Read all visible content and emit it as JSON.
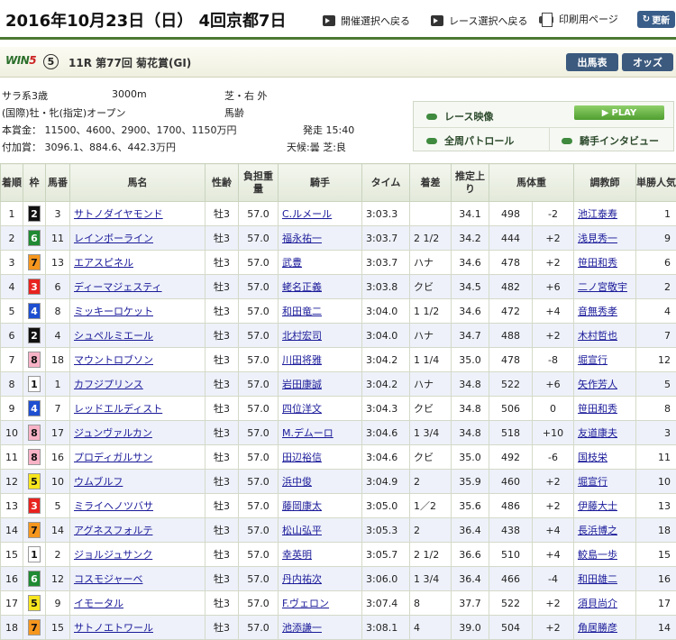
{
  "header": {
    "date": "2016年10月23日（日） 4回京都7日",
    "links": [
      "開催選択へ戻る",
      "レース選択へ戻る",
      "印刷用ページ"
    ],
    "refresh": "更新"
  },
  "race": {
    "win5_text": "WIN",
    "win5_num": "5",
    "win5_leg": "5",
    "title": "11R 第77回 菊花賞(GI)",
    "btn_entries": "出馬表",
    "btn_odds": "オッズ"
  },
  "info": {
    "class": "サラ系3歳",
    "distance": "3000m",
    "course": "芝・右 外",
    "conditions": "(国際)牡・牝(指定)オープン",
    "weight_rule": "馬齢",
    "prize": "本賞金：  11500、4600、2900、1700、1150万円",
    "post_time": "発走 15:40",
    "added_prize": "付加賞：  3096.1、884.6、442.3万円",
    "weather": "天候:曇  芝:良"
  },
  "media": {
    "race_video": "レース映像",
    "play": "PLAY",
    "patrol": "全周パトロール",
    "interview": "騎手インタビュー"
  },
  "table": {
    "headers": [
      "着順",
      "枠",
      "馬番",
      "馬名",
      "性齢",
      "負担重量",
      "騎手",
      "タイム",
      "着差",
      "推定上り",
      "馬体重",
      "",
      "調教師",
      "単勝人気"
    ],
    "rows": [
      {
        "rank": "1",
        "waku": "2",
        "num": "3",
        "horse": "サトノダイヤモンド",
        "sexage": "牡3",
        "weight": "57.0",
        "jockey": "C.ルメール",
        "time": "3:03.3",
        "margin": "",
        "last": "34.1",
        "bw": "498",
        "diff": "-2",
        "trainer": "池江泰寿",
        "pop": "1"
      },
      {
        "rank": "2",
        "waku": "6",
        "num": "11",
        "horse": "レインボーライン",
        "sexage": "牡3",
        "weight": "57.0",
        "jockey": "福永祐一",
        "time": "3:03.7",
        "margin": "2 1/2",
        "last": "34.2",
        "bw": "444",
        "diff": "+2",
        "trainer": "浅見秀一",
        "pop": "9"
      },
      {
        "rank": "3",
        "waku": "7",
        "num": "13",
        "horse": "エアスピネル",
        "sexage": "牡3",
        "weight": "57.0",
        "jockey": "武豊",
        "time": "3:03.7",
        "margin": "ハナ",
        "last": "34.6",
        "bw": "478",
        "diff": "+2",
        "trainer": "笹田和秀",
        "pop": "6"
      },
      {
        "rank": "4",
        "waku": "3",
        "num": "6",
        "horse": "ディーマジェスティ",
        "sexage": "牡3",
        "weight": "57.0",
        "jockey": "蛯名正義",
        "time": "3:03.8",
        "margin": "クビ",
        "last": "34.5",
        "bw": "482",
        "diff": "+6",
        "trainer": "二ノ宮敬宇",
        "pop": "2"
      },
      {
        "rank": "5",
        "waku": "4",
        "num": "8",
        "horse": "ミッキーロケット",
        "sexage": "牡3",
        "weight": "57.0",
        "jockey": "和田竜二",
        "time": "3:04.0",
        "margin": "1 1/2",
        "last": "34.6",
        "bw": "472",
        "diff": "+4",
        "trainer": "音無秀孝",
        "pop": "4"
      },
      {
        "rank": "6",
        "waku": "2",
        "num": "4",
        "horse": "シュペルミエール",
        "sexage": "牡3",
        "weight": "57.0",
        "jockey": "北村宏司",
        "time": "3:04.0",
        "margin": "ハナ",
        "last": "34.7",
        "bw": "488",
        "diff": "+2",
        "trainer": "木村哲也",
        "pop": "7"
      },
      {
        "rank": "7",
        "waku": "8",
        "num": "18",
        "horse": "マウントロブソン",
        "sexage": "牡3",
        "weight": "57.0",
        "jockey": "川田将雅",
        "time": "3:04.2",
        "margin": "1 1/4",
        "last": "35.0",
        "bw": "478",
        "diff": "-8",
        "trainer": "堀宣行",
        "pop": "12"
      },
      {
        "rank": "8",
        "waku": "1",
        "num": "1",
        "horse": "カフジプリンス",
        "sexage": "牡3",
        "weight": "57.0",
        "jockey": "岩田康誠",
        "time": "3:04.2",
        "margin": "ハナ",
        "last": "34.8",
        "bw": "522",
        "diff": "+6",
        "trainer": "矢作芳人",
        "pop": "5"
      },
      {
        "rank": "9",
        "waku": "4",
        "num": "7",
        "horse": "レッドエルディスト",
        "sexage": "牡3",
        "weight": "57.0",
        "jockey": "四位洋文",
        "time": "3:04.3",
        "margin": "クビ",
        "last": "34.8",
        "bw": "506",
        "diff": "0",
        "trainer": "笹田和秀",
        "pop": "8"
      },
      {
        "rank": "10",
        "waku": "8",
        "num": "17",
        "horse": "ジュンヴァルカン",
        "sexage": "牡3",
        "weight": "57.0",
        "jockey": "M.デムーロ",
        "time": "3:04.6",
        "margin": "1 3/4",
        "last": "34.8",
        "bw": "518",
        "diff": "+10",
        "trainer": "友道康夫",
        "pop": "3"
      },
      {
        "rank": "11",
        "waku": "8",
        "num": "16",
        "horse": "プロディガルサン",
        "sexage": "牡3",
        "weight": "57.0",
        "jockey": "田辺裕信",
        "time": "3:04.6",
        "margin": "クビ",
        "last": "35.0",
        "bw": "492",
        "diff": "-6",
        "trainer": "国枝栄",
        "pop": "11"
      },
      {
        "rank": "12",
        "waku": "5",
        "num": "10",
        "horse": "ウムブルフ",
        "sexage": "牡3",
        "weight": "57.0",
        "jockey": "浜中俊",
        "time": "3:04.9",
        "margin": "2",
        "last": "35.9",
        "bw": "460",
        "diff": "+2",
        "trainer": "堀宣行",
        "pop": "10"
      },
      {
        "rank": "13",
        "waku": "3",
        "num": "5",
        "horse": "ミライヘノツバサ",
        "sexage": "牡3",
        "weight": "57.0",
        "jockey": "藤岡康太",
        "time": "3:05.0",
        "margin": "1／2",
        "last": "35.6",
        "bw": "486",
        "diff": "+2",
        "trainer": "伊藤大士",
        "pop": "13"
      },
      {
        "rank": "14",
        "waku": "7",
        "num": "14",
        "horse": "アグネスフォルテ",
        "sexage": "牡3",
        "weight": "57.0",
        "jockey": "松山弘平",
        "time": "3:05.3",
        "margin": "2",
        "last": "36.4",
        "bw": "438",
        "diff": "+4",
        "trainer": "長浜博之",
        "pop": "18"
      },
      {
        "rank": "15",
        "waku": "1",
        "num": "2",
        "horse": "ジョルジュサンク",
        "sexage": "牡3",
        "weight": "57.0",
        "jockey": "幸英明",
        "time": "3:05.7",
        "margin": "2 1/2",
        "last": "36.6",
        "bw": "510",
        "diff": "+4",
        "trainer": "鮫島一歩",
        "pop": "15"
      },
      {
        "rank": "16",
        "waku": "6",
        "num": "12",
        "horse": "コスモジャーベ",
        "sexage": "牡3",
        "weight": "57.0",
        "jockey": "丹内祐次",
        "time": "3:06.0",
        "margin": "1 3/4",
        "last": "36.4",
        "bw": "466",
        "diff": "-4",
        "trainer": "和田雄二",
        "pop": "16"
      },
      {
        "rank": "17",
        "waku": "5",
        "num": "9",
        "horse": "イモータル",
        "sexage": "牡3",
        "weight": "57.0",
        "jockey": "F.ヴェロン",
        "time": "3:07.4",
        "margin": "8",
        "last": "37.7",
        "bw": "522",
        "diff": "+2",
        "trainer": "須貝尚介",
        "pop": "17"
      },
      {
        "rank": "18",
        "waku": "7",
        "num": "15",
        "horse": "サトノエトワール",
        "sexage": "牡3",
        "weight": "57.0",
        "jockey": "池添謙一",
        "time": "3:08.1",
        "margin": "4",
        "last": "39.0",
        "bw": "504",
        "diff": "+2",
        "trainer": "角居勝彦",
        "pop": "14"
      }
    ]
  },
  "waku_colors": {
    "1": {
      "bg": "#ffffff",
      "fg": "#111111"
    },
    "2": {
      "bg": "#111111",
      "fg": "#ffffff"
    },
    "3": {
      "bg": "#e8231f",
      "fg": "#ffffff"
    },
    "4": {
      "bg": "#1f4fd1",
      "fg": "#ffffff"
    },
    "5": {
      "bg": "#f7e51e",
      "fg": "#111111"
    },
    "6": {
      "bg": "#1f8a33",
      "fg": "#ffffff"
    },
    "7": {
      "bg": "#f5961e",
      "fg": "#111111"
    },
    "8": {
      "bg": "#f8b2c6",
      "fg": "#111111"
    }
  }
}
